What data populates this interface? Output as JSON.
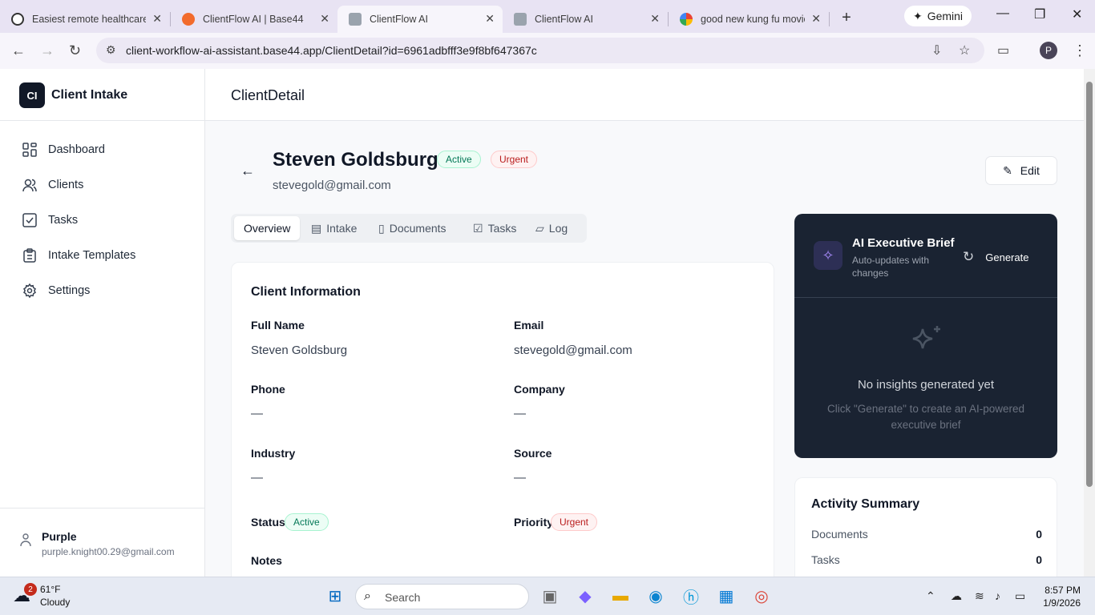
{
  "browser": {
    "tabs": [
      {
        "title": "Easiest remote healthcare",
        "active": false
      },
      {
        "title": "ClientFlow AI | Base44",
        "active": false
      },
      {
        "title": "ClientFlow AI",
        "active": true
      },
      {
        "title": "ClientFlow AI",
        "active": false
      },
      {
        "title": "good new kung fu movie",
        "active": false
      }
    ],
    "gemini_label": "Gemini",
    "url": "client-workflow-ai-assistant.base44.app/ClientDetail?id=6961adbfff3e9f8bf647367c",
    "profile_initial": "P"
  },
  "sidebar": {
    "logo_initials": "CI",
    "app_name": "Client Intake",
    "items": [
      {
        "label": "Dashboard",
        "icon": "grid-icon"
      },
      {
        "label": "Clients",
        "icon": "users-icon"
      },
      {
        "label": "Tasks",
        "icon": "checkbox-icon"
      },
      {
        "label": "Intake Templates",
        "icon": "clipboard-icon"
      },
      {
        "label": "Settings",
        "icon": "gear-icon"
      }
    ],
    "user": {
      "name": "Purple",
      "email": "purple.knight00.29@gmail.com"
    }
  },
  "header": {
    "title": "ClientDetail"
  },
  "client": {
    "name": "Steven Goldsburg",
    "status": "Active",
    "priority": "Urgent",
    "email": "stevegold@gmail.com",
    "edit_label": "Edit"
  },
  "tabs": [
    {
      "label": "Overview",
      "selected": true
    },
    {
      "label": "Intake",
      "selected": false
    },
    {
      "label": "Documents",
      "selected": false
    },
    {
      "label": "Tasks",
      "selected": false
    },
    {
      "label": "Log",
      "selected": false
    }
  ],
  "info": {
    "title": "Client Information",
    "full_name_label": "Full Name",
    "full_name": "Steven Goldsburg",
    "email_label": "Email",
    "email": "stevegold@gmail.com",
    "phone_label": "Phone",
    "phone": "—",
    "company_label": "Company",
    "company": "—",
    "industry_label": "Industry",
    "industry": "—",
    "source_label": "Source",
    "source": "—",
    "status_label": "Status",
    "status": "Active",
    "priority_label": "Priority",
    "priority": "Urgent",
    "notes_label": "Notes"
  },
  "ai_brief": {
    "title": "AI Executive Brief",
    "subtitle": "Auto-updates with changes",
    "generate_label": "Generate",
    "empty_title": "No insights generated yet",
    "empty_hint": "Click \"Generate\" to create an AI-powered executive brief"
  },
  "activity": {
    "title": "Activity Summary",
    "rows": [
      {
        "label": "Documents",
        "value": "0"
      },
      {
        "label": "Tasks",
        "value": "0"
      }
    ]
  },
  "taskbar": {
    "weather_temp": "61°F",
    "weather_desc": "Cloudy",
    "weather_badge": "2",
    "search_label": "Search",
    "time": "8:57 PM",
    "date": "1/9/2026"
  },
  "colors": {
    "accent_dark": "#1a2332",
    "active_green": "#047857",
    "urgent_red": "#b91c1c"
  }
}
